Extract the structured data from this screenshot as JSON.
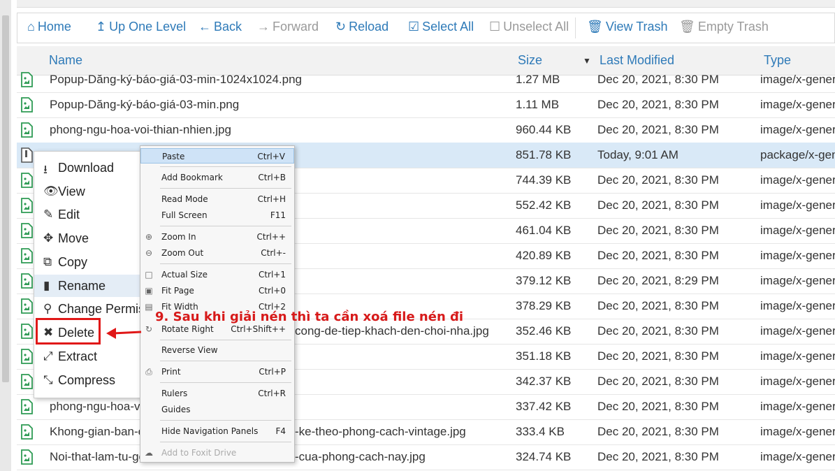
{
  "toolbar": {
    "home": "Home",
    "up": "Up One Level",
    "back": "Back",
    "forward": "Forward",
    "reload": "Reload",
    "select_all": "Select All",
    "unselect_all": "Unselect All",
    "view_trash": "View Trash",
    "empty_trash": "Empty Trash"
  },
  "columns": {
    "name": "Name",
    "size": "Size",
    "modified": "Last Modified",
    "type": "Type"
  },
  "rows": [
    {
      "name": "Popup-Dăng-ký-báo-giá-03-min-1024x1024.png",
      "size": "1.27 MB",
      "date": "Dec 20, 2021, 8:30 PM",
      "type": "image/x-generi"
    },
    {
      "name": "Popup-Dăng-ký-báo-giá-03-min.png",
      "size": "1.11 MB",
      "date": "Dec 20, 2021, 8:30 PM",
      "type": "image/x-generi"
    },
    {
      "name": "phong-ngu-hoa-voi-thian-nhien.jpg",
      "size": "960.44 KB",
      "date": "Dec 20, 2021, 8:30 PM",
      "type": "image/x-generi"
    },
    {
      "name": "",
      "size": "851.78 KB",
      "date": "Today, 9:01 AM",
      "type": "package/x-gen"
    },
    {
      "name": "",
      "size": "744.39 KB",
      "date": "Dec 20, 2021, 8:30 PM",
      "type": "image/x-generi"
    },
    {
      "name": "",
      "size": "552.42 KB",
      "date": "Dec 20, 2021, 8:30 PM",
      "type": "image/x-generi"
    },
    {
      "name": "",
      "size": "461.04 KB",
      "date": "Dec 20, 2021, 8:30 PM",
      "type": "image/x-generi"
    },
    {
      "name": "",
      "size": "420.89 KB",
      "date": "Dec 20, 2021, 8:30 PM",
      "type": "image/x-generi"
    },
    {
      "name": "",
      "size": "379.12 KB",
      "date": "Dec 20, 2021, 8:29 PM",
      "type": "image/x-generi"
    },
    {
      "name": "",
      "size": "378.29 KB",
      "date": "Dec 20, 2021, 8:30 PM",
      "type": "image/x-generi"
    },
    {
      "name": "cong-de-tiep-khach-den-choi-nha.jpg",
      "size": "352.46 KB",
      "date": "Dec 20, 2021, 8:30 PM",
      "type": "image/x-generi"
    },
    {
      "name": "",
      "size": "351.18 KB",
      "date": "Dec 20, 2021, 8:30 PM",
      "type": "image/x-generi"
    },
    {
      "name": "",
      "size": "342.37 KB",
      "date": "Dec 20, 2021, 8:30 PM",
      "type": "image/x-generi"
    },
    {
      "name": "phong-ngu-hoa-vo",
      "size": "337.42 KB",
      "date": "Dec 20, 2021, 8:30 PM",
      "type": "image/x-generi"
    },
    {
      "name": "Khong-gian-ban-c",
      "name2": "-ke-theo-phong-cach-vintage.jpg",
      "size": "333.4 KB",
      "date": "Dec 20, 2021, 8:30 PM",
      "type": "image/x-generi"
    },
    {
      "name": "Noi-that-lam-tu-go",
      "name2": "-cua-phong-cach-nay.jpg",
      "size": "324.74 KB",
      "date": "Dec 20, 2021, 8:30 PM",
      "type": "image/x-generi"
    }
  ],
  "context_menu": {
    "download": "Download",
    "view": "View",
    "edit": "Edit",
    "move": "Move",
    "copy": "Copy",
    "rename": "Rename",
    "change_perms": "Change Permis",
    "delete": "Delete",
    "extract": "Extract",
    "compress": "Compress"
  },
  "foxit_menu": {
    "paste": "Paste",
    "paste_sc": "Ctrl+V",
    "add_bookmark": "Add Bookmark",
    "add_bookmark_sc": "Ctrl+B",
    "read_mode": "Read Mode",
    "read_mode_sc": "Ctrl+H",
    "full_screen": "Full Screen",
    "full_screen_sc": "F11",
    "zoom_in": "Zoom In",
    "zoom_in_sc": "Ctrl++",
    "zoom_out": "Zoom Out",
    "zoom_out_sc": "Ctrl+-",
    "actual_size": "Actual Size",
    "actual_size_sc": "Ctrl+1",
    "fit_page": "Fit Page",
    "fit_page_sc": "Ctrl+0",
    "fit_width": "Fit Width",
    "fit_width_sc": "Ctrl+2",
    "rotate_right": "Rotate Right",
    "rotate_right_sc": "Ctrl+Shift++",
    "reverse_view": "Reverse View",
    "print": "Print",
    "print_sc": "Ctrl+P",
    "rulers": "Rulers",
    "rulers_sc": "Ctrl+R",
    "guides": "Guides",
    "hide_nav": "Hide Navigation Panels",
    "hide_nav_sc": "F4",
    "add_foxit": "Add to Foxit Drive"
  },
  "annotation": "9. Sau khi giải nén thì ta cần xoá file nén đi",
  "colors": {
    "link": "#2e7ab8",
    "file_icon": "#2e9b54",
    "highlight": "#e01818"
  }
}
